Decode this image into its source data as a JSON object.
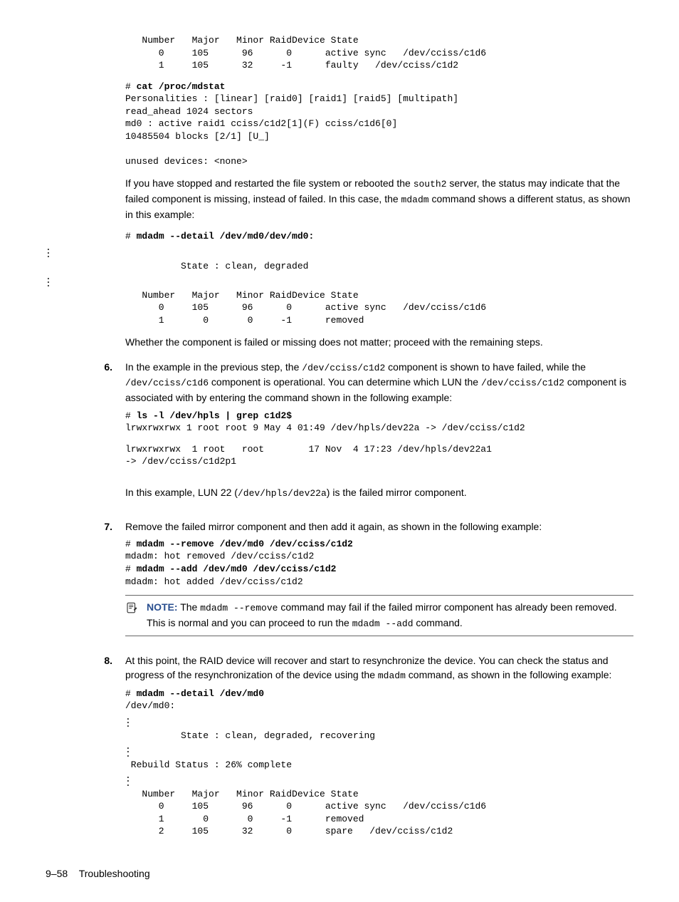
{
  "code": {
    "block1_table": "   Number   Major   Minor RaidDevice State\n      0     105      96      0      active sync   /dev/cciss/c1d6\n      1     105      32     -1      faulty   /dev/cciss/c1d2",
    "block1_cmd_prefix": "# ",
    "block1_cmd": "cat /proc/mdstat",
    "block1_out": "Personalities : [linear] [raid0] [raid1] [raid5] [multipath]\nread_ahead 1024 sectors\nmd0 : active raid1 cciss/c1d2[1](F) cciss/c1d6[0]\n10485504 blocks [2/1] [U_]\n\nunused devices: <none>",
    "block2_cmd_prefix": "# ",
    "block2_cmd": "mdadm --detail /dev/md0/dev/md0:",
    "block2_state": "          State : clean, degraded",
    "block2_table": "   Number   Major   Minor RaidDevice State\n      0     105      96      0      active sync   /dev/cciss/c1d6\n      1       0       0     -1      removed",
    "block6_cmd_prefix": "# ",
    "block6_cmd": "ls -l /dev/hpls | grep c1d2$",
    "block6_out1": "lrwxrwxrwx 1 root root 9 May 4 01:49 /dev/hpls/dev22a -> /dev/cciss/c1d2",
    "block6_out2": "lrwxrwxrwx  1 root   root        17 Nov  4 17:23 /dev/hpls/dev22a1\n-> /dev/cciss/c1d2p1",
    "block7_l1_prefix": "# ",
    "block7_l1_cmd": "mdadm --remove /dev/md0 /dev/cciss/c1d2",
    "block7_l2": "mdadm: hot removed /dev/cciss/c1d2",
    "block7_l3_prefix": "# ",
    "block7_l3_cmd": "mdadm --add /dev/md0 /dev/cciss/c1d2",
    "block7_l4": "mdadm: hot added /dev/cciss/c1d2",
    "block8_cmd_prefix": "# ",
    "block8_cmd": "mdadm --detail /dev/md0",
    "block8_dev": "/dev/md0:",
    "block8_state": "          State : clean, degraded, recovering",
    "block8_rebuild": " Rebuild Status : 26% complete",
    "block8_table": "   Number   Major   Minor RaidDevice State\n      0     105      96      0      active sync   /dev/cciss/c1d6\n      1       0       0     -1      removed\n      2     105      32      0      spare   /dev/cciss/c1d2"
  },
  "text": {
    "p1a": "If you have stopped and restarted the file system or rebooted the ",
    "p1_code1": "south2",
    "p1b": " server, the status may indicate that the failed component is missing, instead of failed. In this case, the ",
    "p1_code2": "mdadm",
    "p1c": " command shows a different status, as shown in this example:",
    "p2": "Whether the component is failed or missing does not matter; proceed with the remaining steps.",
    "s6_num": "6.",
    "s6a": "In the example in the previous step, the ",
    "s6_code1": "/dev/cciss/c1d2",
    "s6b": " component is shown to have failed, while the ",
    "s6_code2": "/dev/cciss/c1d6",
    "s6c": " component is operational. You can determine which LUN the ",
    "s6_code3": "/dev/cciss/c1d2",
    "s6d": " component is associated with by entering the command shown in the following example:",
    "s6e": "In this example, LUN 22 (",
    "s6_code4": "/dev/hpls/dev22a",
    "s6f": ") is the failed mirror component.",
    "s7_num": "7.",
    "s7a": "Remove the failed mirror component and then add it again, as shown in the following example:",
    "note_label": "NOTE:",
    "note_a": "  The ",
    "note_code1": "mdadm --remove",
    "note_b": " command may fail if the failed mirror component has already been removed. This is normal and you can proceed to run the ",
    "note_code2": "mdadm --add",
    "note_c": " command.",
    "s8_num": "8.",
    "s8a": "At this point, the RAID device will recover and start to resynchronize the device. You can check the status and progress of the resynchronization of the device using the ",
    "s8_code1": "mdadm",
    "s8b": " command, as shown in the following example:"
  },
  "footer": {
    "page": "9–58",
    "section": "Troubleshooting"
  }
}
